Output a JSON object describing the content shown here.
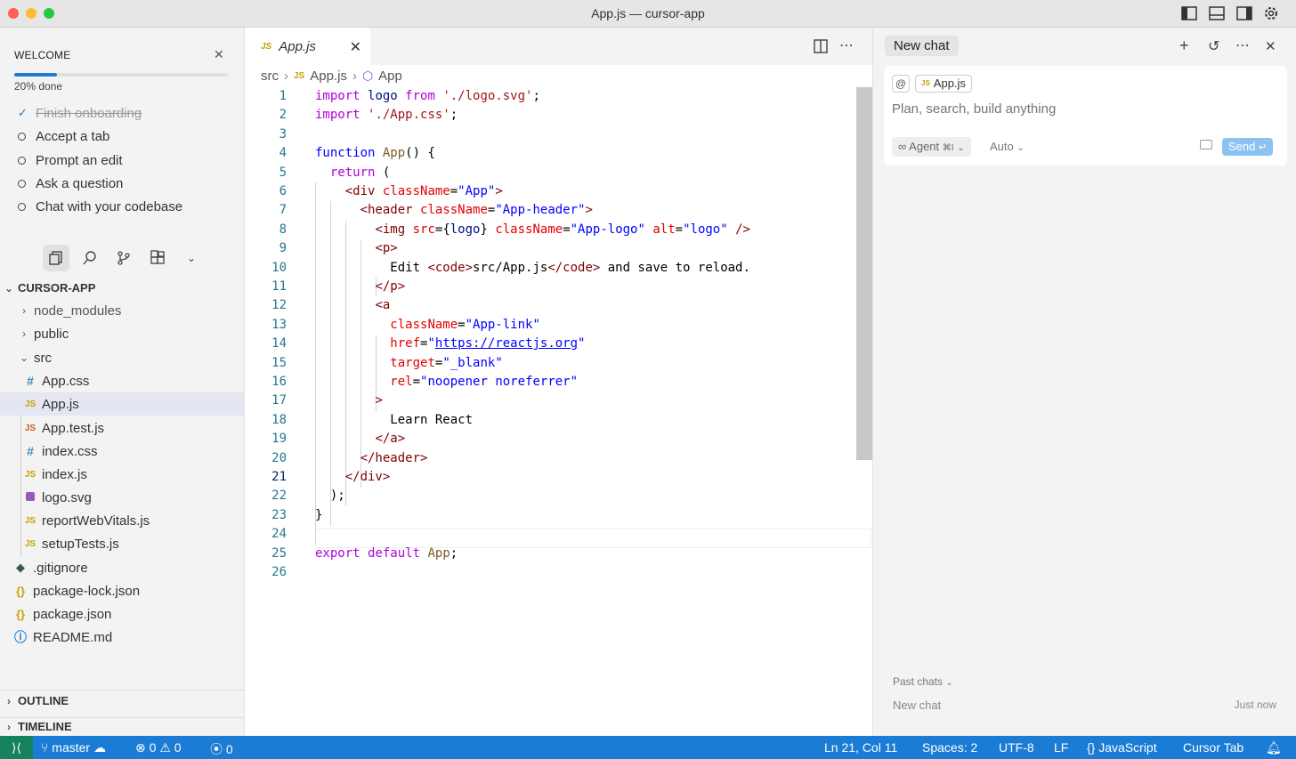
{
  "window": {
    "title": "App.js — cursor-app"
  },
  "welcome": {
    "title": "WELCOME",
    "progress_text": "20% done",
    "progress": 0.2,
    "tasks": [
      {
        "label": "Finish onboarding",
        "done": true
      },
      {
        "label": "Accept a tab",
        "done": false
      },
      {
        "label": "Prompt an edit",
        "done": false
      },
      {
        "label": "Ask a question",
        "done": false
      },
      {
        "label": "Chat with your codebase",
        "done": false
      }
    ]
  },
  "explorer": {
    "root": "CURSOR-APP",
    "items": [
      {
        "label": "node_modules",
        "type": "folder"
      },
      {
        "label": "public",
        "type": "folder"
      },
      {
        "label": "src",
        "type": "folder-open"
      },
      {
        "label": "App.css",
        "type": "css"
      },
      {
        "label": "App.js",
        "type": "js"
      },
      {
        "label": "App.test.js",
        "type": "js"
      },
      {
        "label": "index.css",
        "type": "css"
      },
      {
        "label": "index.js",
        "type": "js"
      },
      {
        "label": "logo.svg",
        "type": "svg"
      },
      {
        "label": "reportWebVitals.js",
        "type": "js"
      },
      {
        "label": "setupTests.js",
        "type": "js"
      },
      {
        "label": ".gitignore",
        "type": "git"
      },
      {
        "label": "package-lock.json",
        "type": "json"
      },
      {
        "label": "package.json",
        "type": "json"
      },
      {
        "label": "README.md",
        "type": "info"
      }
    ],
    "outline": "OUTLINE",
    "timeline": "TIMELINE"
  },
  "editor": {
    "tab_label": "App.js",
    "tab_badge": "JS",
    "breadcrumb": [
      "src",
      "App.js",
      "App"
    ],
    "current_line": 21
  },
  "chat": {
    "tab_label": "New chat",
    "context_chip": "App.js",
    "placeholder": "Plan, search, build anything",
    "agent_label": "Agent",
    "agent_shortcut": "⌘I",
    "model_label": "Auto",
    "send_label": "Send",
    "past_chats": "Past chats",
    "past_items": [
      {
        "title": "New chat",
        "time": "Just now"
      }
    ]
  },
  "status": {
    "branch": "master",
    "errors": "0",
    "warnings": "0",
    "ports": "0",
    "position": "Ln 21, Col 11",
    "spaces": "Spaces: 2",
    "encoding": "UTF-8",
    "eol": "LF",
    "language": "JavaScript",
    "cursor_tab": "Cursor Tab"
  },
  "colors": {
    "accent": "#1a7cd4",
    "remote": "#16825d",
    "keyword": "#af00db",
    "string": "#a31515",
    "tag": "#800000",
    "attribute": "#e50000"
  }
}
